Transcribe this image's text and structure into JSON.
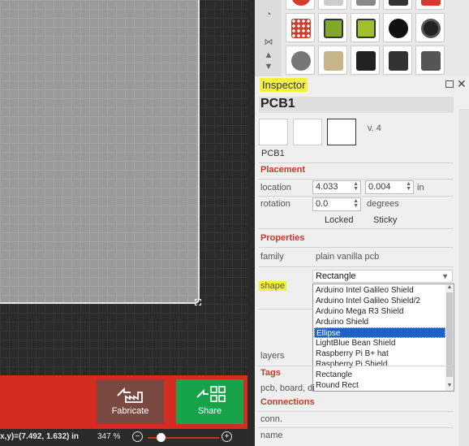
{
  "canvas": {
    "status": {
      "coords": "x,y)=(7.492, 1.632) in",
      "zoom": "347 %",
      "zoom_minus": "−",
      "zoom_plus": "+"
    }
  },
  "toolbar": {
    "fabricate_label": "Fabricate",
    "share_label": "Share"
  },
  "parts_bin": {
    "side_icons": [
      "seeed-icon",
      "fritzing-logo-icon",
      "scroll-up-icon",
      "scroll-down-icon"
    ],
    "tiles": [
      "red-led-matrix",
      "rgb-led-matrix",
      "lcd-display-16x2",
      "lcd-display-20x4",
      "piezo-buzzer",
      "speaker",
      "pressure-sensor",
      "dc-motor",
      "motor-driver",
      "servo-motor",
      "stepper-motor",
      "led-strip",
      "ic-chip",
      "rfid-module",
      "speaker-small"
    ]
  },
  "inspector": {
    "title": "Inspector",
    "part_name": "PCB1",
    "version": "v. 4",
    "instance_title": "PCB1",
    "placement": {
      "section": "Placement",
      "location_label": "location",
      "location_x": "4.033",
      "location_y": "0.004",
      "location_unit": "in",
      "rotation_label": "rotation",
      "rotation_value": "0.0",
      "rotation_unit": "degrees",
      "locked_label": "Locked",
      "sticky_label": "Sticky"
    },
    "properties": {
      "section": "Properties",
      "family_label": "family",
      "family_value": "plain vanilla pcb",
      "shape_label": "shape",
      "shape_value": "Rectangle",
      "shape_options": [
        "Arduino Intel Galileo Shield",
        "Arduino Intel Galileo Shield/2",
        "Arduino Mega R3 Shield",
        "Arduino Shield",
        "Ellipse",
        "LightBlue Bean Shield",
        "Raspberry Pi B+ hat",
        "Raspberry Pi Shield",
        "Rectangle",
        "Round Rect"
      ],
      "shape_highlighted": "Ellipse",
      "layers_label": "layers"
    },
    "tags": {
      "section": "Tags",
      "value": "pcb, board, di"
    },
    "connections": {
      "section": "Connections",
      "conn_label": "conn.",
      "name_label": "name"
    }
  },
  "colors": {
    "toolbar_red": "#d42c21",
    "share_green": "#16a34a",
    "fabricate_brown": "#7a4a42",
    "section_red": "#c53a25",
    "highlight_yellow": "#f4f23a",
    "selection_blue": "#1e62c8"
  }
}
